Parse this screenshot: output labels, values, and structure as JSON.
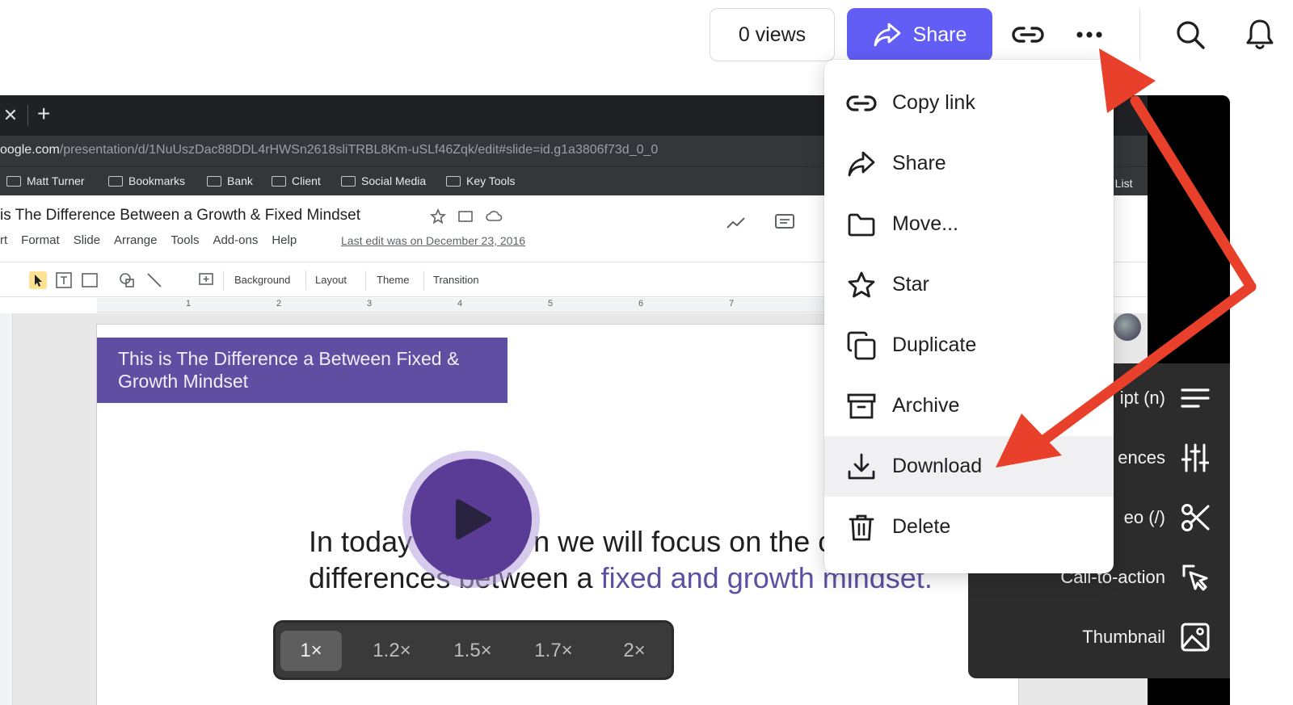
{
  "header": {
    "views_label": "0 views",
    "share_label": "Share",
    "icons": [
      "share-arrow-icon",
      "link-icon",
      "more-dots-icon",
      "search-icon",
      "bell-icon"
    ]
  },
  "browser": {
    "url_host": "oogle.com",
    "url_path": "/presentation/d/1NuUszDac88DDL4rHWSn2618sliTRBL8Km-uSLf46Zqk/edit#slide=id.g1a3806f73d_0_0",
    "bookmarks": [
      "Matt Turner",
      "Bookmarks",
      "Bank",
      "Client",
      "Social Media",
      "Key Tools"
    ],
    "right_clip": "g List"
  },
  "slides_app": {
    "doc_title": "is The Difference Between a Growth & Fixed Mindset",
    "menus": [
      "rt",
      "Format",
      "Slide",
      "Arrange",
      "Tools",
      "Add-ons",
      "Help"
    ],
    "last_edit": "Last edit was on December 23, 2016",
    "toolbar": {
      "background": "Background",
      "layout": "Layout",
      "theme": "Theme",
      "transition": "Transition"
    },
    "ruler_numbers": [
      "1",
      "2",
      "3",
      "4",
      "5",
      "6",
      "7"
    ],
    "slide": {
      "banner": "This is The  Difference a Between Fixed & Growth Mindset",
      "body_prefix": "In today",
      "body_mid": "n we will focus on the c",
      "body_line2": "differences between a ",
      "body_accent": "fixed and growth mindset."
    }
  },
  "player": {
    "speeds": [
      "1×",
      "1.2×",
      "1.5×",
      "1.7×",
      "2×"
    ],
    "active_speed": "1×"
  },
  "side_panel": {
    "items": [
      {
        "label": "ipt (n)",
        "icon": "transcript-lines-icon"
      },
      {
        "label": "ences",
        "icon": "sliders-icon"
      },
      {
        "label": "eo (/)",
        "icon": "scissors-icon"
      },
      {
        "label": "Call-to-action",
        "icon": "cursor-click-icon"
      },
      {
        "label": "Thumbnail",
        "icon": "image-icon"
      }
    ]
  },
  "dropdown": {
    "items": [
      {
        "label": "Copy link",
        "icon": "link-icon"
      },
      {
        "label": "Share",
        "icon": "share-arrow-icon"
      },
      {
        "label": "Move...",
        "icon": "folder-icon"
      },
      {
        "label": "Star",
        "icon": "star-icon"
      },
      {
        "label": "Duplicate",
        "icon": "duplicate-icon"
      },
      {
        "label": "Archive",
        "icon": "archive-icon"
      },
      {
        "label": "Download",
        "icon": "download-icon"
      },
      {
        "label": "Delete",
        "icon": "trash-icon"
      }
    ],
    "highlighted": "Download"
  },
  "colors": {
    "accent": "#625df5",
    "slide_purple": "#5e4fa2",
    "annotation_red": "#e8402a"
  }
}
